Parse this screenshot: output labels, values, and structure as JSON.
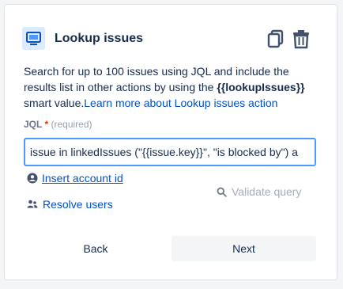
{
  "header": {
    "title": "Lookup issues",
    "icon": "monitor-icon",
    "actions": [
      "copy-icon",
      "trash-icon"
    ]
  },
  "description": {
    "text": "Search for up to 100 issues using JQL and include the results list in other actions by using the ",
    "smart_value": "{{lookupIssues}}",
    "suffix": " smart value.",
    "link": "Learn more about Lookup issues action"
  },
  "jql": {
    "label": "JQL",
    "required_marker": "*",
    "required_text": "(required)",
    "value": "issue in linkedIssues (\"{{issue.key}}\", \"is blocked by\") a"
  },
  "links": {
    "insert_account_id": "Insert account id",
    "resolve_users": "Resolve users",
    "validate_query": "Validate query"
  },
  "buttons": {
    "back": "Back",
    "next": "Next"
  },
  "colors": {
    "link": "#0052cc",
    "focus_border": "#4c9aff",
    "icon_bg": "#deebff",
    "required": "#de350b"
  }
}
